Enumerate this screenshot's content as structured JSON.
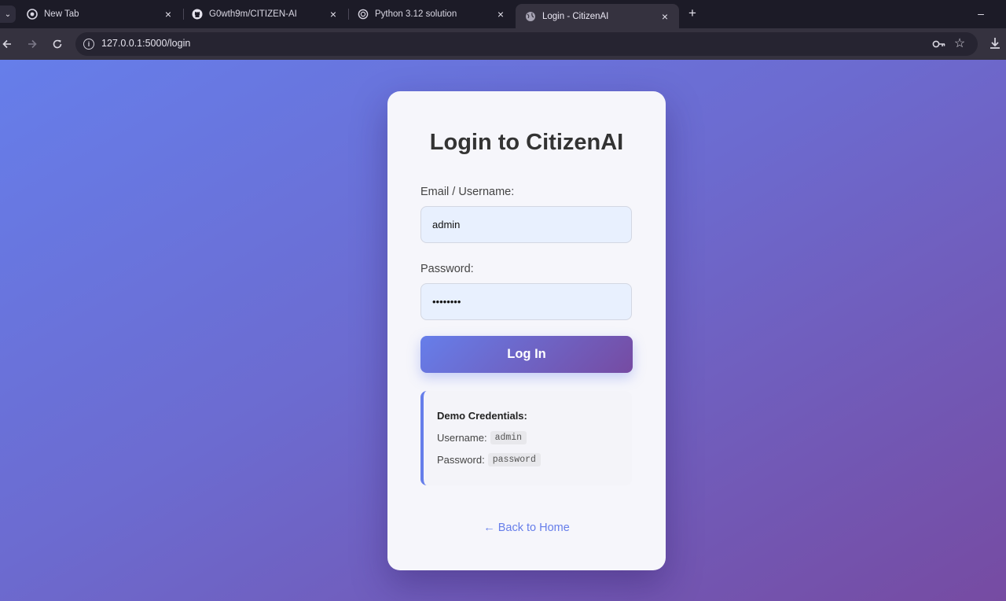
{
  "browser": {
    "tabs": [
      {
        "title": "New Tab",
        "icon": "chrome-icon",
        "active": false
      },
      {
        "title": "G0wth9m/CITIZEN-AI",
        "icon": "github-icon",
        "active": false
      },
      {
        "title": "Python 3.12 solution",
        "icon": "chatgpt-icon",
        "active": false
      },
      {
        "title": "Login - CitizenAI",
        "icon": "globe-icon",
        "active": true
      }
    ],
    "url": "127.0.0.1:5000/login"
  },
  "login": {
    "title": "Login to CitizenAI",
    "username_label": "Email / Username:",
    "username_value": "admin",
    "password_label": "Password:",
    "password_value": "password",
    "submit_label": "Log In"
  },
  "demo": {
    "title": "Demo Credentials:",
    "username_label": "Username:",
    "username_value": "admin",
    "password_label": "Password:",
    "password_value": "password"
  },
  "back_link": "← Back to Home",
  "colors": {
    "accent_start": "#667eea",
    "accent_end": "#764ba2"
  }
}
